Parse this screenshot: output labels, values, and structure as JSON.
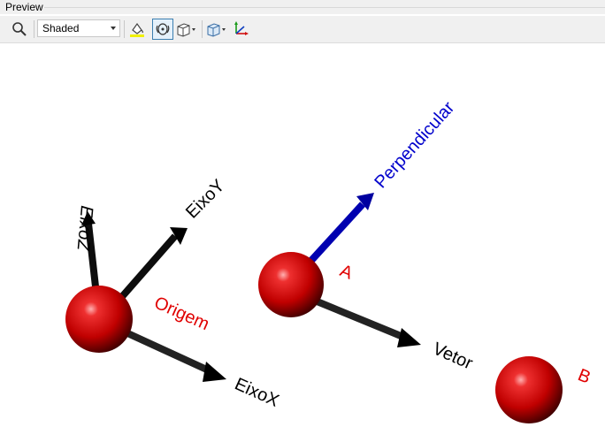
{
  "panel": {
    "title": "Preview"
  },
  "toolbar": {
    "render_mode": "Shaded",
    "icons": [
      "zoom-icon",
      "fill-color-icon",
      "rotate-icon",
      "box-view-icon",
      "cube-view-icon",
      "axes-icon"
    ]
  },
  "scene": {
    "labels": {
      "eixoz": "EixoZ",
      "eixoy": "EixoY",
      "eixox": "EixoX",
      "origem": "Origem",
      "perpendicular": "Perpendicular",
      "a": "A",
      "vetor": "Vetor",
      "b": "B"
    },
    "colors": {
      "sphere": "#cc0000",
      "axis": "#111111",
      "perpendicular": "#0000cc",
      "point_label": "#e00000",
      "perp_label": "#0000cc",
      "text": "#000000"
    }
  }
}
